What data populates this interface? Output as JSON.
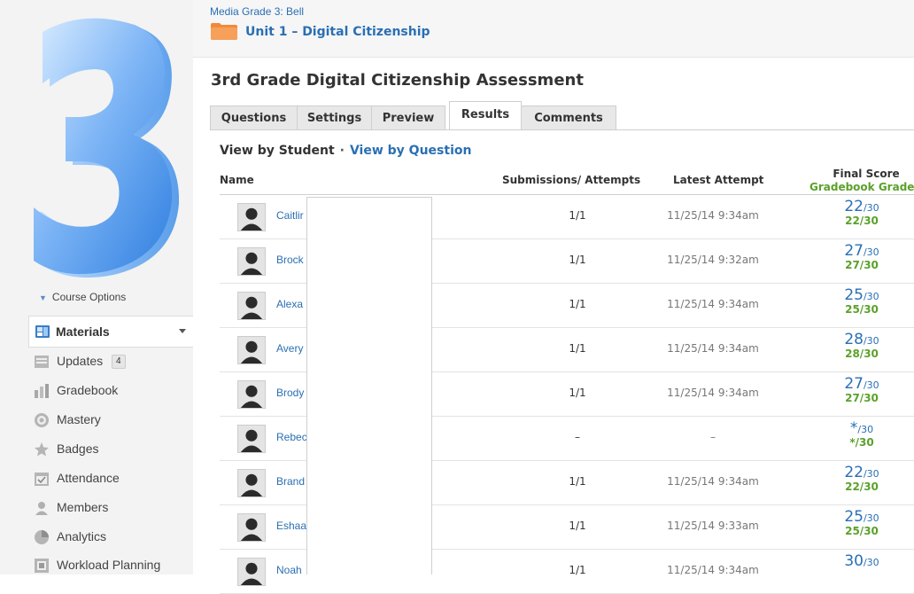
{
  "sidebar": {
    "logo_icon": "number-3-logo",
    "course_options": "Course Options",
    "materials_label": "Materials",
    "items": [
      {
        "label": "Updates",
        "icon": "updates-icon",
        "count": "4"
      },
      {
        "label": "Gradebook",
        "icon": "gradebook-icon"
      },
      {
        "label": "Mastery",
        "icon": "mastery-icon"
      },
      {
        "label": "Badges",
        "icon": "badges-icon"
      },
      {
        "label": "Attendance",
        "icon": "attendance-icon"
      },
      {
        "label": "Members",
        "icon": "members-icon"
      },
      {
        "label": "Analytics",
        "icon": "analytics-icon"
      },
      {
        "label": "Workload Planning",
        "icon": "workload-planning-icon"
      }
    ]
  },
  "breadcrumb": {
    "course": "Media Grade 3: Bell",
    "unit": "Unit 1 – Digital Citizenship"
  },
  "page": {
    "title": "3rd Grade Digital Citizenship Assessment"
  },
  "tabs": [
    "Questions",
    "Settings",
    "Preview",
    "Results",
    "Comments"
  ],
  "active_tab": "Results",
  "view": {
    "by_student": "View by Student",
    "separator": "·",
    "by_question": "View by Question"
  },
  "table": {
    "headers": {
      "name": "Name",
      "submissions": "Submissions/ Attempts",
      "latest": "Latest Attempt",
      "final_score": "Final Score",
      "gradebook_grade": "Gradebook Grade"
    },
    "rows": [
      {
        "name": "Caitlir",
        "submissions": "1/1",
        "latest": "11/25/14 9:34am",
        "score": "22",
        "out_of": "/30",
        "grade": "22/30"
      },
      {
        "name": "Brock",
        "submissions": "1/1",
        "latest": "11/25/14 9:32am",
        "score": "27",
        "out_of": "/30",
        "grade": "27/30"
      },
      {
        "name": "Alexa",
        "submissions": "1/1",
        "latest": "11/25/14 9:34am",
        "score": "25",
        "out_of": "/30",
        "grade": "25/30"
      },
      {
        "name": "Avery",
        "submissions": "1/1",
        "latest": "11/25/14 9:34am",
        "score": "28",
        "out_of": "/30",
        "grade": "28/30"
      },
      {
        "name": "Brody",
        "submissions": "1/1",
        "latest": "11/25/14 9:34am",
        "score": "27",
        "out_of": "/30",
        "grade": "27/30"
      },
      {
        "name": "Rebec",
        "submissions": "–",
        "latest": "–",
        "score": "*",
        "out_of": "/30",
        "grade": "*/30"
      },
      {
        "name": "Brand",
        "submissions": "1/1",
        "latest": "11/25/14 9:34am",
        "score": "22",
        "out_of": "/30",
        "grade": "22/30"
      },
      {
        "name": "Eshaa",
        "submissions": "1/1",
        "latest": "11/25/14 9:33am",
        "score": "25",
        "out_of": "/30",
        "grade": "25/30"
      },
      {
        "name": "Noah",
        "submissions": "1/1",
        "latest": "11/25/14 9:34am",
        "score": "30",
        "out_of": "/30",
        "grade": ""
      }
    ]
  },
  "colors": {
    "link": "#2a6fb3",
    "grade_green": "#5aa12a",
    "logo_blue": "#4a90e2"
  }
}
